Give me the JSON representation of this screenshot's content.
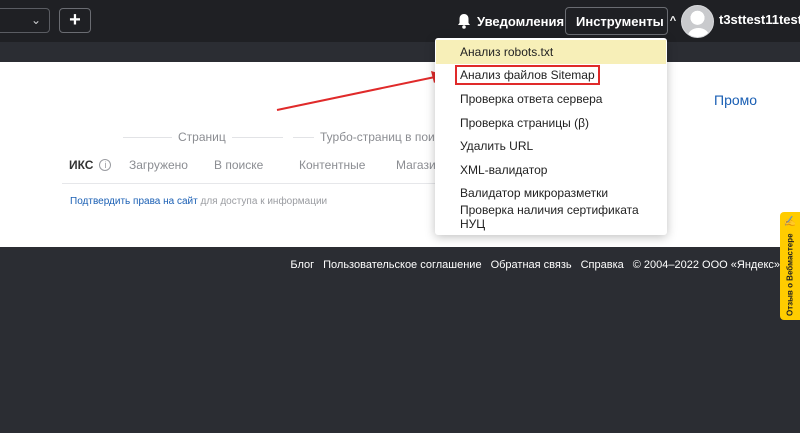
{
  "header": {
    "select_chevron": "⌄",
    "add_button": "+",
    "notifications_label": "Уведомления",
    "tools_label": "Инструменты",
    "tools_chevron": "^",
    "username": "t3sttest11test"
  },
  "tools_menu": {
    "items": [
      "Анализ robots.txt",
      "Анализ файлов Sitemap",
      "Проверка ответа сервера",
      "Проверка страницы (β)",
      "Удалить URL",
      "XML-валидатор",
      "Валидатор микроразметки",
      "Проверка наличия сертификата НУЦ"
    ]
  },
  "main": {
    "promo_link": "Промо",
    "group_pages": "Страниц",
    "group_turbo": "Турбо-страниц в поиске",
    "iks_label": "ИКС",
    "info_icon": "i",
    "columns": [
      "Загружено",
      "В поиске",
      "Контентные",
      "Магазин"
    ],
    "verify_link": "Подтвердить права на сайт",
    "verify_text": " для доступа к информации"
  },
  "footer": {
    "links": [
      "Блог",
      "Пользовательское соглашение",
      "Обратная связь",
      "Справка",
      "© 2004–2022 ООО «Яндекс»"
    ]
  },
  "feedback_tab": {
    "label": "Отзыв о Вебмастере",
    "icon": "✍"
  },
  "colors": {
    "annotation_red": "#e02a2a",
    "hover_yellow": "#f7efb8",
    "feedback_yellow": "#ffcc00",
    "link_blue": "#1a5fb4"
  }
}
